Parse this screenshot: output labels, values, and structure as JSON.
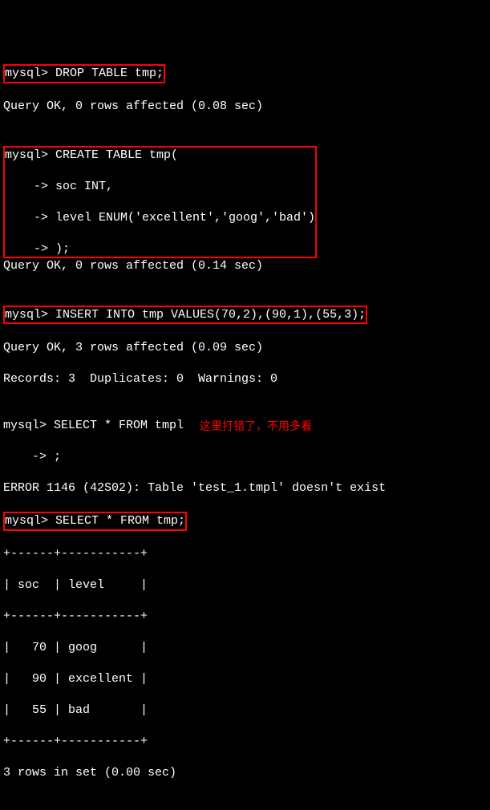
{
  "lines": {
    "l1": "mysql> DROP TABLE tmp;",
    "l2": "Query OK, 0 rows affected (0.08 sec)",
    "l3": "",
    "l4a": "mysql> CREATE TABLE tmp(",
    "l4b": "    -> soc INT,",
    "l4c": "    -> level ENUM('excellent','goog','bad')",
    "l4d": "    -> );",
    "l5": "Query OK, 0 rows affected (0.14 sec)",
    "l6": "",
    "l7": "mysql> INSERT INTO tmp VALUES(70,2),(90,1),(55,3);",
    "l8": "Query OK, 3 rows affected (0.09 sec)",
    "l9": "Records: 3  Duplicates: 0  Warnings: 0",
    "l10": "",
    "l11": "mysql> SELECT * FROM tmpl",
    "l12": "    -> ;",
    "l13": "ERROR 1146 (42S02): Table 'test_1.tmpl' doesn't exist",
    "l14": "mysql> SELECT * FROM tmp;",
    "l15": "+------+-----------+",
    "l16": "| soc  | level     |",
    "l17": "+------+-----------+",
    "l18": "|   70 | goog      |",
    "l19": "|   90 | excellent |",
    "l20": "|   55 | bad       |",
    "l21": "+------+-----------+",
    "l22": "3 rows in set (0.00 sec)"
  },
  "annotation": "这里打错了，不用多看",
  "chart_data": {
    "type": "table",
    "columns": [
      "soc",
      "level"
    ],
    "rows": [
      {
        "soc": 70,
        "level": "goog"
      },
      {
        "soc": 90,
        "level": "excellent"
      },
      {
        "soc": 55,
        "level": "bad"
      }
    ],
    "summary": "3 rows in set (0.00 sec)"
  }
}
